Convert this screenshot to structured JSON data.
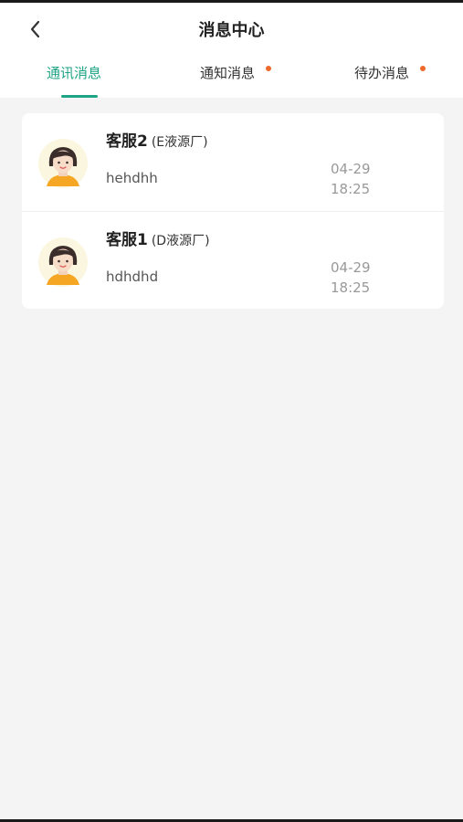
{
  "header": {
    "title": "消息中心"
  },
  "tabs": [
    {
      "label": "通讯消息",
      "active": true,
      "dot": false
    },
    {
      "label": "通知消息",
      "active": false,
      "dot": true
    },
    {
      "label": "待办消息",
      "active": false,
      "dot": true
    }
  ],
  "conversations": [
    {
      "name": "客服2",
      "org": "(E液源厂)",
      "preview": "hehdhh",
      "date": "04-29",
      "time": "18:25"
    },
    {
      "name": "客服1",
      "org": "(D液源厂)",
      "preview": "hdhdhd",
      "date": "04-29",
      "time": "18:25"
    }
  ],
  "colors": {
    "accent": "#1ea385",
    "badge": "#ee6a2c",
    "background": "#f4f4f4"
  },
  "icons": {
    "back": "chevron-left-icon",
    "avatar": "female-avatar-icon"
  }
}
